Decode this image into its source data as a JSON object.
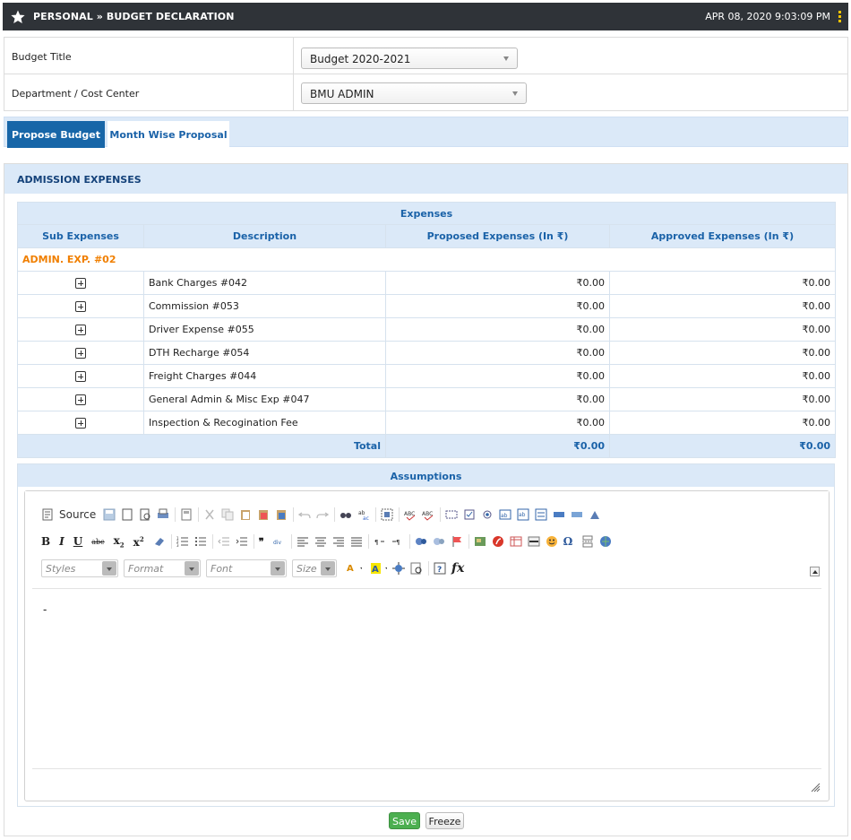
{
  "header": {
    "title": "PERSONAL » BUDGET DECLARATION",
    "datetime": "APR 08, 2020  9:03:09 PM",
    "icon": "star-icon",
    "accent_color": "#f5c400",
    "bar_color": "#2f3338"
  },
  "form": {
    "budget_title_label": "Budget Title",
    "budget_title_value": "Budget 2020-2021",
    "department_label": "Department / Cost Center",
    "department_value": "BMU ADMIN"
  },
  "tabs": [
    {
      "label": "Propose Budget",
      "active": true
    },
    {
      "label": "Month Wise Proposal",
      "active": false
    }
  ],
  "section": {
    "title": "ADMISSION EXPENSES"
  },
  "table": {
    "group_header": "Expenses",
    "columns": [
      "Sub Expenses",
      "Description",
      "Proposed Expenses (In ₹)",
      "Approved Expenses (In ₹)"
    ],
    "group_label": "ADMIN. EXP. #02",
    "rows": [
      {
        "description": "Bank Charges #042",
        "proposed": "₹0.00",
        "approved": "₹0.00"
      },
      {
        "description": "Commission #053",
        "proposed": "₹0.00",
        "approved": "₹0.00"
      },
      {
        "description": "Driver Expense #055",
        "proposed": "₹0.00",
        "approved": "₹0.00"
      },
      {
        "description": "DTH Recharge #054",
        "proposed": "₹0.00",
        "approved": "₹0.00"
      },
      {
        "description": "Freight Charges #044",
        "proposed": "₹0.00",
        "approved": "₹0.00"
      },
      {
        "description": "General Admin & Misc Exp #047",
        "proposed": "₹0.00",
        "approved": "₹0.00"
      },
      {
        "description": "Inspection & Recogination Fee",
        "proposed": "₹0.00",
        "approved": "₹0.00"
      }
    ],
    "total_label": "Total",
    "total_proposed": "₹0.00",
    "total_approved": "₹0.00"
  },
  "assumptions": {
    "title": "Assumptions",
    "source_label": "Source",
    "styles_placeholder": "Styles",
    "format_placeholder": "Format",
    "font_placeholder": "Font",
    "size_placeholder": "Size",
    "content": "-"
  },
  "actions": {
    "save_label": "Save",
    "freeze_label": "Freeze",
    "save_color": "#4caf50"
  }
}
